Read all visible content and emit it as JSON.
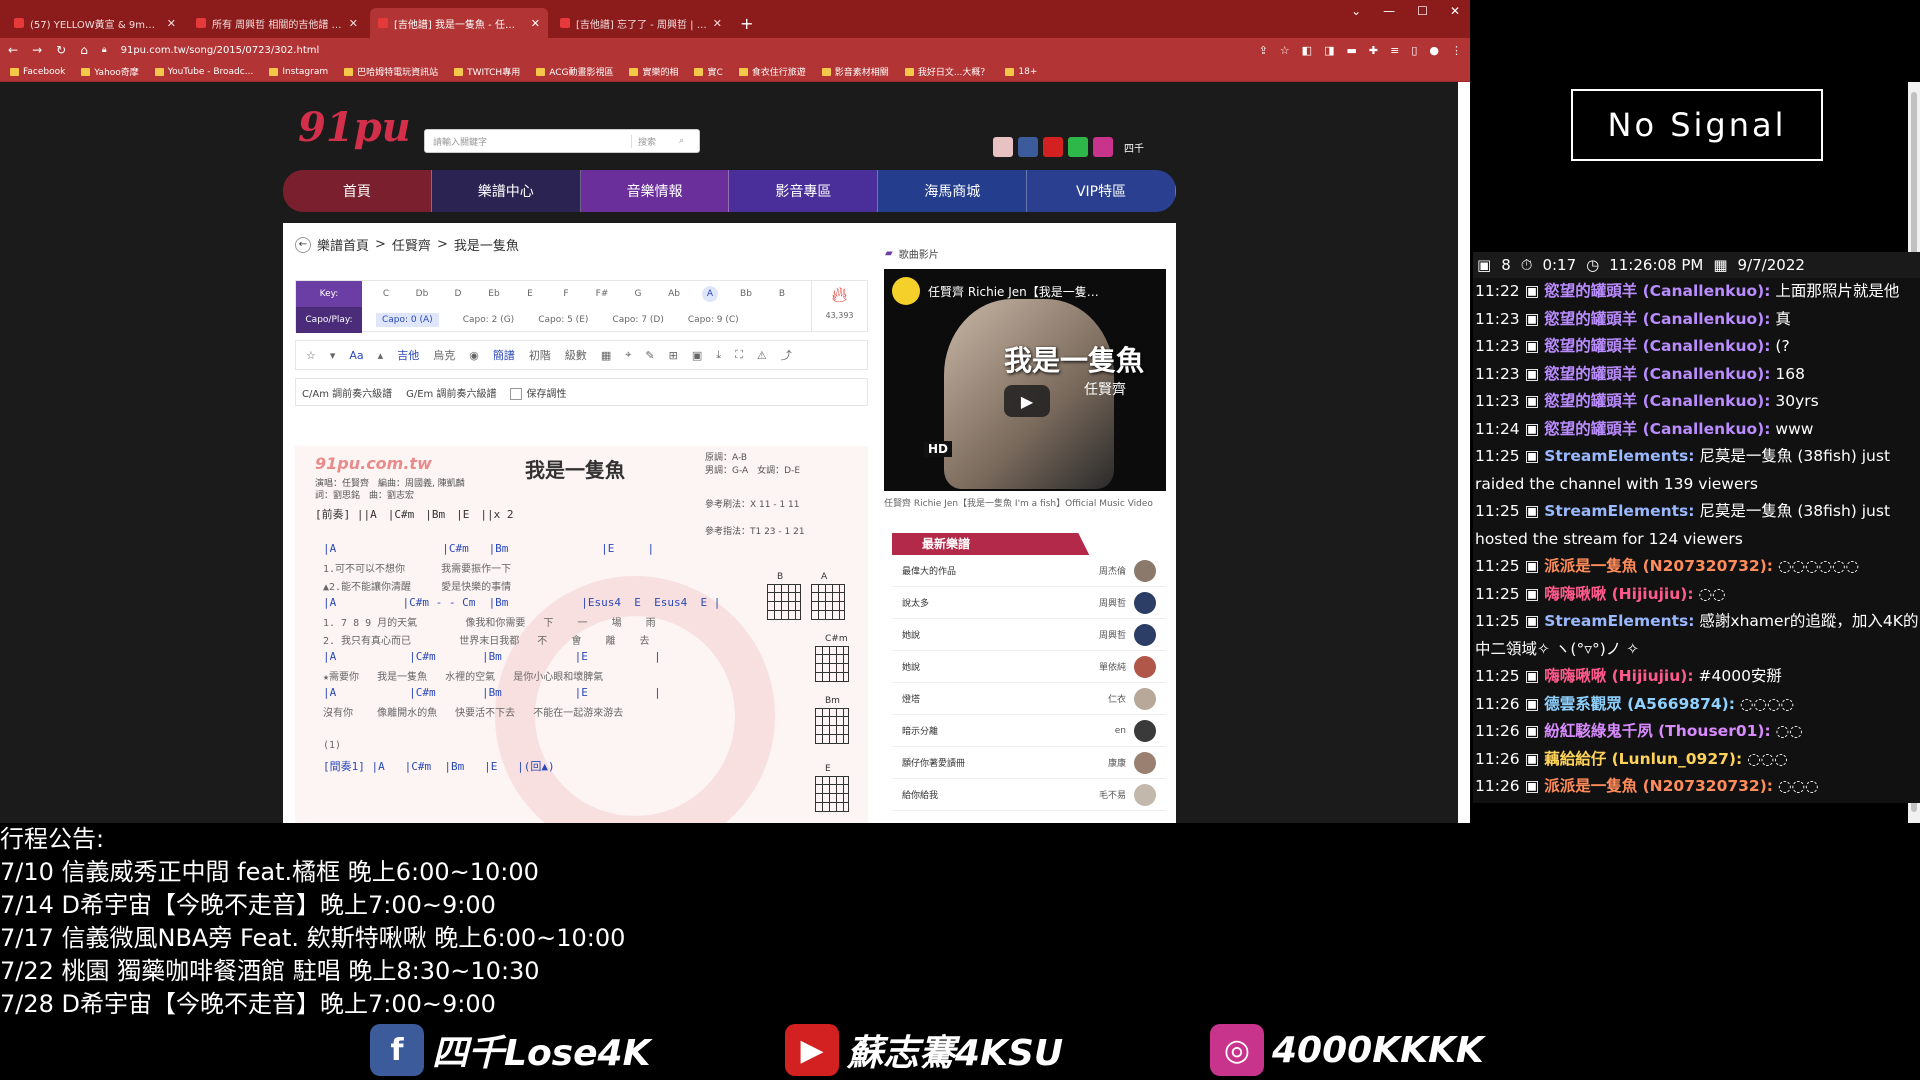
{
  "browser": {
    "tabs": [
      {
        "label": "(57) YELLOW黃宣 & 9m88 - 任…",
        "active": false
      },
      {
        "label": "所有 周興哲 相關的吉他譜 | 91譜…",
        "active": false
      },
      {
        "label": "[吉他譜] 我是一隻魚 - 任賢齊 | 9…",
        "active": true
      },
      {
        "label": "[吉他譜] 忘了了 - 周興哲 | 91譜 -…",
        "active": false
      }
    ],
    "url": "91pu.com.tw/song/2015/0723/302.html",
    "bookmarks": [
      "Facebook",
      "Yahoo奇摩",
      "YouTube - Broadc...",
      "Instagram",
      "巴哈姆特電玩資訊站",
      "TWITCH專用",
      "ACG動畫影視區",
      "實樂的相",
      "實C",
      "食衣住行旅遊",
      "影音素材相關",
      "我好日文...大概？",
      "18+"
    ]
  },
  "site": {
    "logo_text": "91pu",
    "search_placeholder": "請輸入關鍵字",
    "search_type": "搜索",
    "user_name": "四千",
    "nav": [
      "首頁",
      "樂譜中心",
      "音樂情報",
      "影音專區",
      "海馬商城",
      "VIP特區"
    ],
    "breadcrumb": [
      "樂譜首頁",
      "任賢齊",
      "我是一隻魚"
    ],
    "key_label": "Key:",
    "keys": [
      "C",
      "Db",
      "D",
      "Eb",
      "E",
      "F",
      "F#",
      "G",
      "Ab",
      "A",
      "Bb",
      "B"
    ],
    "selected_key": "A",
    "capo_label": "Capo/Play:",
    "capos": [
      "Capo: 0 (A)",
      "Capo: 2 (G)",
      "Capo: 5 (E)",
      "Capo: 7 (D)",
      "Capo: 9 (C)"
    ],
    "hot_count": "43,393",
    "toolbar": [
      "Aa",
      "吉他",
      "烏克",
      "簡譜",
      "初階",
      "級數"
    ],
    "options": [
      "C/Am 調前奏六級譜",
      "G/Em 調前奏六級譜",
      "保存調性"
    ],
    "sheet": {
      "site_mark": "91pu.com.tw",
      "title": "我是一隻魚",
      "credits": [
        "演唱：任賢齊　編曲：周國義, 陳凱麟",
        "詞：劉思銘　曲：劉志宏"
      ],
      "key_info": [
        "原調：A-B",
        "男調：G-A　女調：D-E"
      ],
      "strum1": "參考刷法：X 11 - 1 11",
      "strum2": "參考指法：T1 23 - 1 21",
      "intro": "[前奏] ||A　|C#m　|Bm　|E　||x 2",
      "lines": [
        {
          "c": "|A                |C#m   |Bm              |E     |"
        },
        {
          "l": "1.可不可以不想你      我需要振作一下"
        },
        {
          "l": "▲2.能不能讓你清醒     愛是快樂的事情"
        },
        {
          "c": "|A          |C#m - - Cm  |Bm           |Esus4  E  Esus4  E |"
        },
        {
          "l": "1. 7 8 9 月的天氣        像我和你需要   下    一    場    雨"
        },
        {
          "l": "2. 我只有真心而已        世界末日我都   不    會    離    去"
        },
        {
          "c": "|A           |C#m       |Bm           |E          |"
        },
        {
          "l": "★需要你   我是一隻魚   水裡的空氣   是你小心眼和壞脾氣"
        },
        {
          "c": "|A           |C#m       |Bm           |E          |"
        },
        {
          "l": "沒有你    像離開水的魚   快要活不下去   不能在一起游來游去"
        },
        {
          "l": "(1)"
        },
        {
          "c": "[間奏1] |A   |C#m  |Bm   |E   |(回▲)"
        }
      ],
      "chords": [
        "B",
        "A",
        "C#m",
        "Bm",
        "E"
      ]
    },
    "video_section": "歌曲影片",
    "video_title": "任賢齊 Richie Jen【我是一隻…",
    "video_big": "我是一隻魚",
    "video_sub": "任賢齊",
    "video_hd": "HD",
    "video_caption": "任賢齊 Richie Jen【我是一隻魚 I'm a fish】Official Music Video",
    "new_header": "最新樂譜",
    "new_sheets": [
      {
        "song": "最偉大的作品",
        "artist": "周杰倫"
      },
      {
        "song": "說太多",
        "artist": "周興哲"
      },
      {
        "song": "她說",
        "artist": "周興哲"
      },
      {
        "song": "她說",
        "artist": "單依純"
      },
      {
        "song": "燈塔",
        "artist": "仁衣"
      },
      {
        "song": "暗示分離",
        "artist": "en"
      },
      {
        "song": "願仔你著愛讀冊",
        "artist": "康康"
      },
      {
        "song": "給你給我",
        "artist": "毛不易"
      }
    ]
  },
  "no_signal": "No Signal",
  "chat": {
    "header": {
      "viewers": "8",
      "uptime": "0:17",
      "clock": "11:26:08 PM",
      "date": "9/7/2022"
    },
    "messages": [
      {
        "time": "11:22",
        "user": "慾望的罐頭羊 (Canallenkuo):",
        "text": "上面那照片就是他",
        "color": "#b98cff"
      },
      {
        "time": "11:23",
        "user": "慾望的罐頭羊 (Canallenkuo):",
        "text": "真",
        "color": "#b98cff"
      },
      {
        "time": "11:23",
        "user": "慾望的罐頭羊 (Canallenkuo):",
        "text": "(?",
        "color": "#b98cff"
      },
      {
        "time": "11:23",
        "user": "慾望的罐頭羊 (Canallenkuo):",
        "text": "168",
        "color": "#b98cff"
      },
      {
        "time": "11:23",
        "user": "慾望的罐頭羊 (Canallenkuo):",
        "text": "30yrs",
        "color": "#b98cff"
      },
      {
        "time": "11:24",
        "user": "慾望的罐頭羊 (Canallenkuo):",
        "text": "www",
        "color": "#b98cff"
      },
      {
        "time": "11:25",
        "user": "StreamElements:",
        "text": "尼莫是一隻魚 (38fish) just raided the channel with 139 viewers",
        "color": "#9ab8ff"
      },
      {
        "time": "11:25",
        "user": "StreamElements:",
        "text": "尼莫是一隻魚 (38fish) just hosted the stream for 124 viewers",
        "color": "#9ab8ff"
      },
      {
        "time": "11:25",
        "user": "派派是一隻魚 (N207320732):",
        "text": "◌◌◌◌◌◌",
        "color": "#ff8c5a"
      },
      {
        "time": "11:25",
        "user": "嗨嗨啾啾 (Hijiujiu):",
        "text": "◌◌",
        "color": "#ff5a8c"
      },
      {
        "time": "11:25",
        "user": "StreamElements:",
        "text": "感謝xhamer的追蹤，加入4K的中二領域✧ ヽ(°▿°)ノ ✧",
        "color": "#9ab8ff"
      },
      {
        "time": "11:25",
        "user": "嗨嗨啾啾 (Hijiujiu):",
        "text": "#4000安掰",
        "color": "#ff5a8c"
      },
      {
        "time": "11:26",
        "user": "德雲系觀眾 (A5669874):",
        "text": "◌◌◌◌",
        "color": "#8fd1ff"
      },
      {
        "time": "11:26",
        "user": "紛紅駭綠鬼千夙 (Thouser01):",
        "text": "◌◌",
        "color": "#d88bff"
      },
      {
        "time": "11:26",
        "user": "藕給給仔 (Lunlun_0927):",
        "text": "◌◌◌",
        "color": "#ffd35a"
      },
      {
        "time": "11:26",
        "user": "派派是一隻魚 (N207320732):",
        "text": "◌◌◌",
        "color": "#ff8c5a"
      }
    ]
  },
  "announcement": [
    "行程公告:",
    "7/10 信義威秀正中間 feat.橘框 晚上6:00~10:00",
    "7/14 D希宇宙【今晚不走音】晚上7:00~9:00",
    "7/17 信義微風NBA旁 Feat. 欸斯特啾啾 晚上6:00~10:00",
    "7/22 桃園 獨藥咖啡餐酒館 駐唱 晚上8:30~10:30",
    "7/28 D希宇宙【今晚不走音】晚上7:00~9:00"
  ],
  "footer": [
    {
      "icon": "facebook-icon",
      "glyph": "f",
      "label": "四千Lose4K",
      "color": "#3b5b9a"
    },
    {
      "icon": "youtube-icon",
      "glyph": "▶",
      "label": "蘇志騫4KSU",
      "color": "#d32020"
    },
    {
      "icon": "instagram-icon",
      "glyph": "◎",
      "label": "4000KKKK",
      "color": "#c8338c"
    }
  ],
  "colors": {
    "nav_active": "#2b2352",
    "nav_purple": "#6a2f9a",
    "nav_blue": "#243d8c",
    "tab_red": "#8c1b1b"
  }
}
